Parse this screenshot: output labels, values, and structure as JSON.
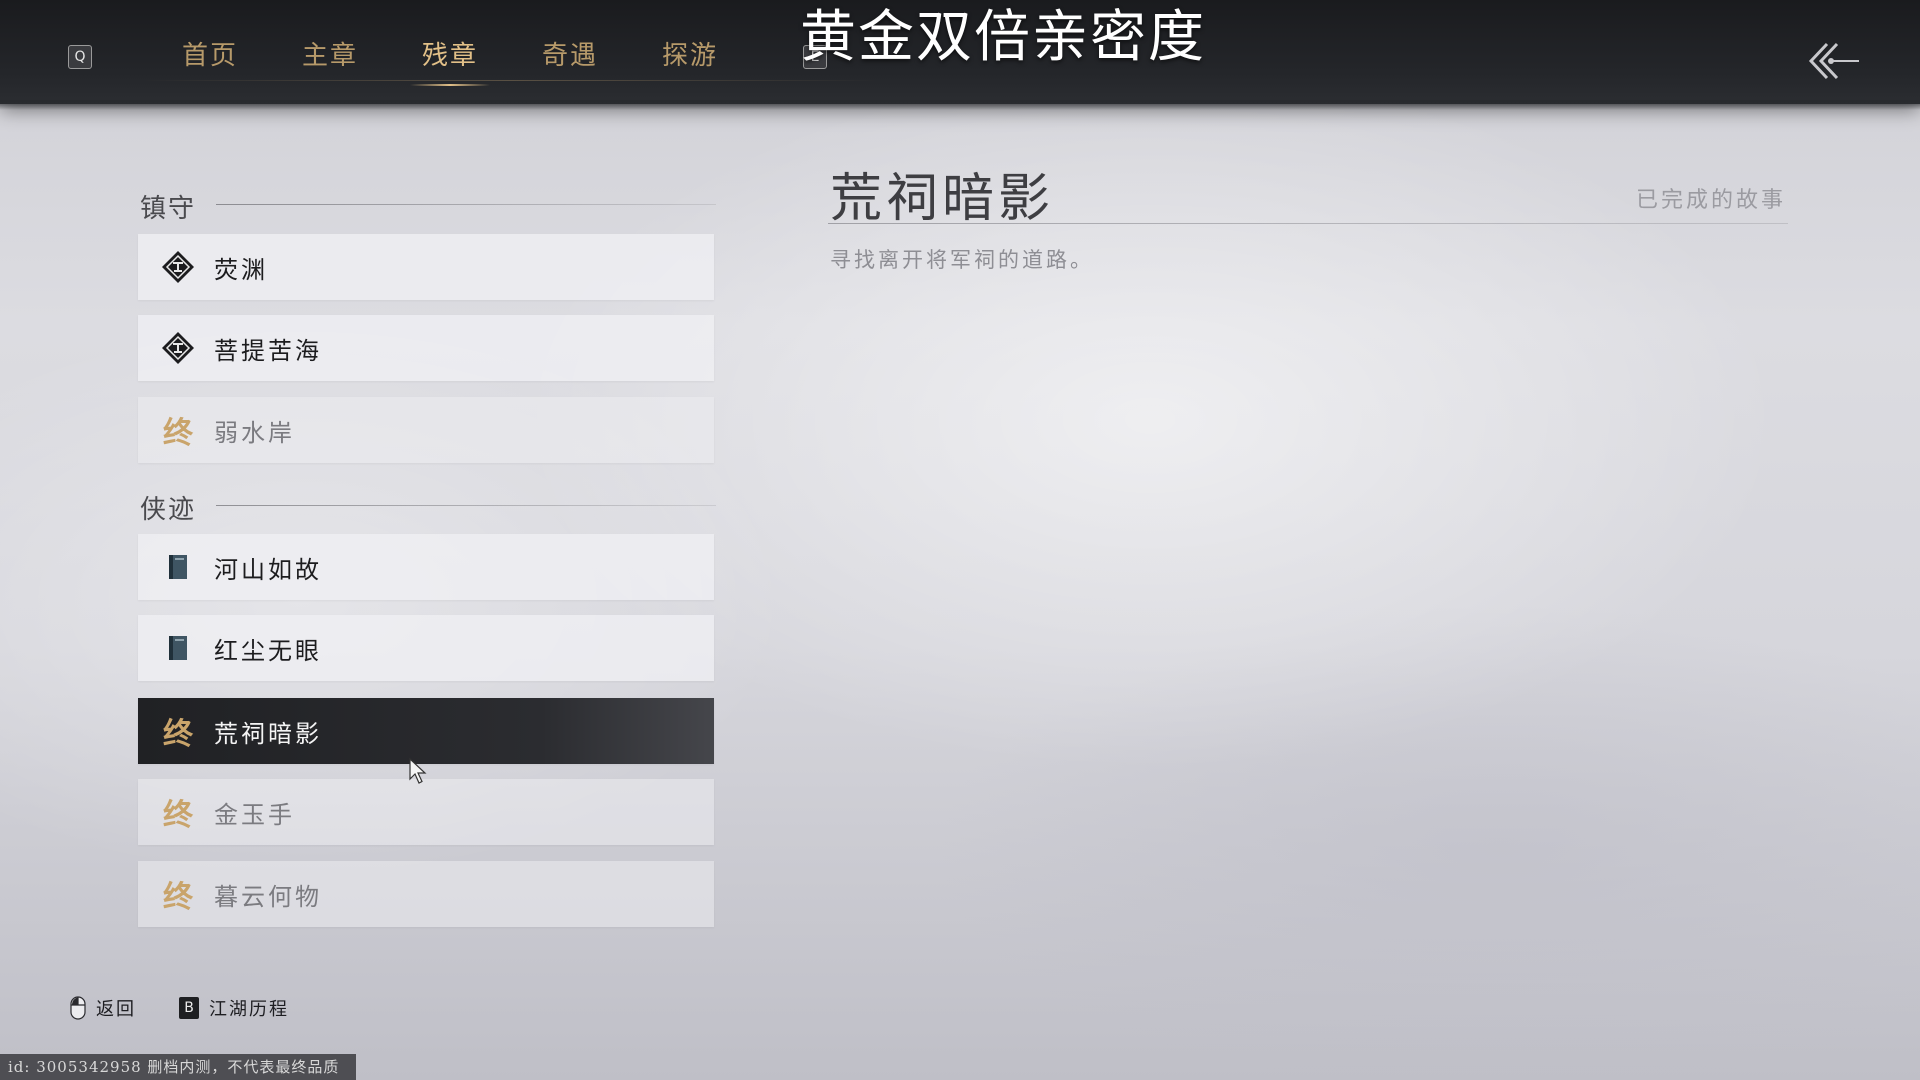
{
  "overlay_title": "黄金双倍亲密度",
  "topbar": {
    "left_key": "Q",
    "right_key": "E",
    "tabs": [
      {
        "label": "首页",
        "active": false
      },
      {
        "label": "主章",
        "active": false
      },
      {
        "label": "残章",
        "active": true
      },
      {
        "label": "奇遇",
        "active": false
      },
      {
        "label": "探游",
        "active": false
      }
    ],
    "back_icon": "double-chevron-left-icon"
  },
  "sections": [
    {
      "title": "镇守",
      "items": [
        {
          "label": "荧渊",
          "icon": "diamond-marker-icon",
          "state": "available"
        },
        {
          "label": "菩提苦海",
          "icon": "diamond-marker-icon",
          "state": "available"
        },
        {
          "label": "弱水岸",
          "icon": "end-seal-icon",
          "state": "completed"
        }
      ]
    },
    {
      "title": "侠迹",
      "items": [
        {
          "label": "河山如故",
          "icon": "book-icon",
          "state": "available"
        },
        {
          "label": "红尘无眼",
          "icon": "book-icon",
          "state": "available"
        },
        {
          "label": "荒祠暗影",
          "icon": "end-seal-icon",
          "state": "completed",
          "selected": true
        },
        {
          "label": "金玉手",
          "icon": "end-seal-icon",
          "state": "completed"
        },
        {
          "label": "暮云何物",
          "icon": "end-seal-icon",
          "state": "completed"
        }
      ]
    }
  ],
  "end_glyph": "终",
  "detail": {
    "title": "荒祠暗影",
    "status": "已完成的故事",
    "description": "寻找离开将军祠的道路。"
  },
  "hints": {
    "back_label": "返回",
    "journey_key": "B",
    "journey_label": "江湖历程"
  },
  "watermark": "id: 3005342958  删档内测，不代表最终品质",
  "colors": {
    "accent_gold": "#e2c088",
    "tab_gold": "#b79a6a",
    "seal_gold": "#c9a46b",
    "selected_bg": "#202124"
  }
}
